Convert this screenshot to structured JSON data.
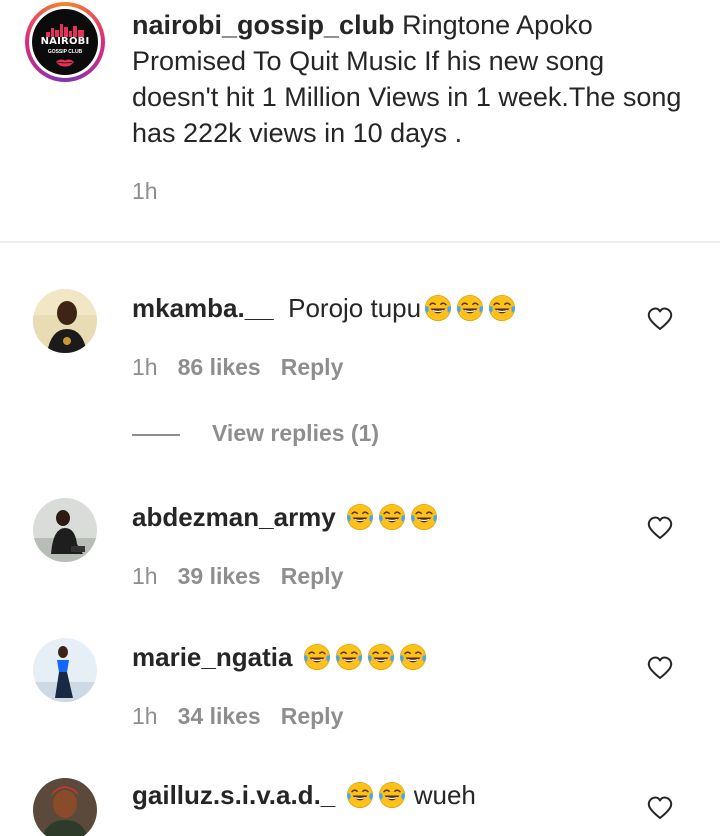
{
  "caption": {
    "username": "nairobi_gossip_club",
    "text": "Ringtone Apoko Promised To Quit Music If his new song doesn't hit 1 Million Views in 1 week.The song has 222k views in 10 days .",
    "time": "1h",
    "logo": {
      "title": "NAIROBI",
      "subtitle": "GOSSIP CLUB"
    }
  },
  "comments": [
    {
      "username": "mkamba.__",
      "text": "Porojo tupu",
      "emoji_count": 3,
      "emoji": "face-with-tears-of-joy",
      "time": "1h",
      "likes": "86 likes",
      "reply": "Reply",
      "view_replies": "View replies (1)"
    },
    {
      "username": "abdezman_army",
      "text": "",
      "emoji_count": 3,
      "emoji": "face-with-tears-of-joy",
      "time": "1h",
      "likes": "39 likes",
      "reply": "Reply"
    },
    {
      "username": "marie_ngatia",
      "text": "",
      "emoji_count": 4,
      "emoji": "face-with-tears-of-joy",
      "time": "1h",
      "likes": "34 likes",
      "reply": "Reply"
    },
    {
      "username": "gailluz.s.i.v.a.d._",
      "text": "",
      "emoji_count": 2,
      "emoji": "face-with-tears-of-joy",
      "text_after": "wueh"
    }
  ],
  "colors": {
    "text": "#262626",
    "muted": "#8e8e8e",
    "divider": "#efefef",
    "emoji_face": "#fcc21b"
  }
}
